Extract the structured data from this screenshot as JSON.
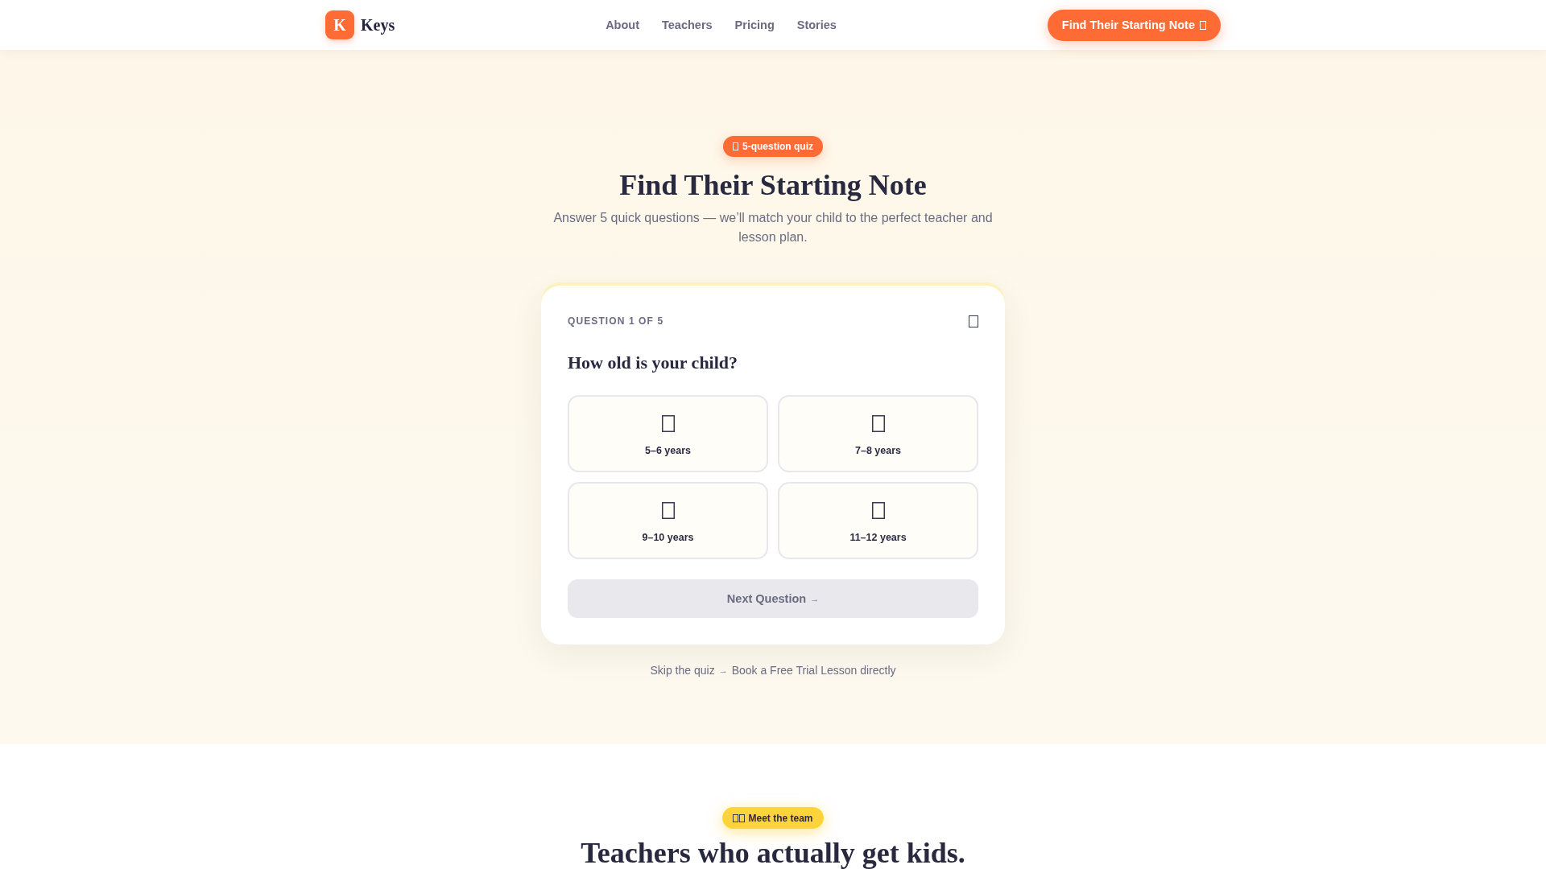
{
  "header": {
    "logo_letter": "K",
    "brand": "Keys",
    "nav": [
      "About",
      "Teachers",
      "Pricing",
      "Stories"
    ],
    "cta": "Find Their Starting Note"
  },
  "hero": {
    "badge": "5-question quiz",
    "title": "Find Their Starting Note",
    "subtitle": "Answer 5 quick questions — we’ll match your child to the perfect teacher and lesson plan."
  },
  "quiz": {
    "progress_label": "QUESTION 1 OF 5",
    "question": "How old is your child?",
    "options": [
      {
        "label": "5–6 years",
        "selected": false
      },
      {
        "label": "7–8 years",
        "selected": false
      },
      {
        "label": "9–10 years",
        "selected": false
      },
      {
        "label": "11–12 years",
        "selected": false
      }
    ],
    "next_button": {
      "label": "Next Question",
      "arrow": "→",
      "disabled": true
    },
    "skip": {
      "text": "Skip the quiz",
      "arrow": "→",
      "link": "Book a Free Trial Lesson directly"
    }
  },
  "team": {
    "badge": "Meet the team",
    "title": "Teachers who actually get kids."
  }
}
